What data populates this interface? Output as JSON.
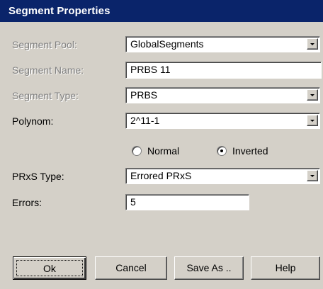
{
  "window": {
    "title": "Segment Properties"
  },
  "form": {
    "segment_pool": {
      "label": "Segment Pool:",
      "value": "GlobalSegments",
      "disabled": true
    },
    "segment_name": {
      "label": "Segment Name:",
      "value": "PRBS 11",
      "disabled": true
    },
    "segment_type": {
      "label": "Segment Type:",
      "value": "PRBS",
      "disabled": true
    },
    "polynom": {
      "label": "Polynom:",
      "value": "2^11-1"
    },
    "polarity": {
      "options": [
        {
          "label": "Normal",
          "selected": false
        },
        {
          "label": "Inverted",
          "selected": true
        }
      ]
    },
    "prxs_type": {
      "label": "PRxS Type:",
      "value": "Errored PRxS"
    },
    "errors": {
      "label": "Errors:",
      "value": "5"
    }
  },
  "buttons": {
    "ok": "Ok",
    "cancel": "Cancel",
    "save_as": "Save As ..",
    "help": "Help"
  },
  "icons": {
    "dropdown": "chevron-down-icon"
  },
  "colors": {
    "titlebar": "#0a246a",
    "face": "#d4d0c8",
    "disabled_text": "#808080"
  }
}
